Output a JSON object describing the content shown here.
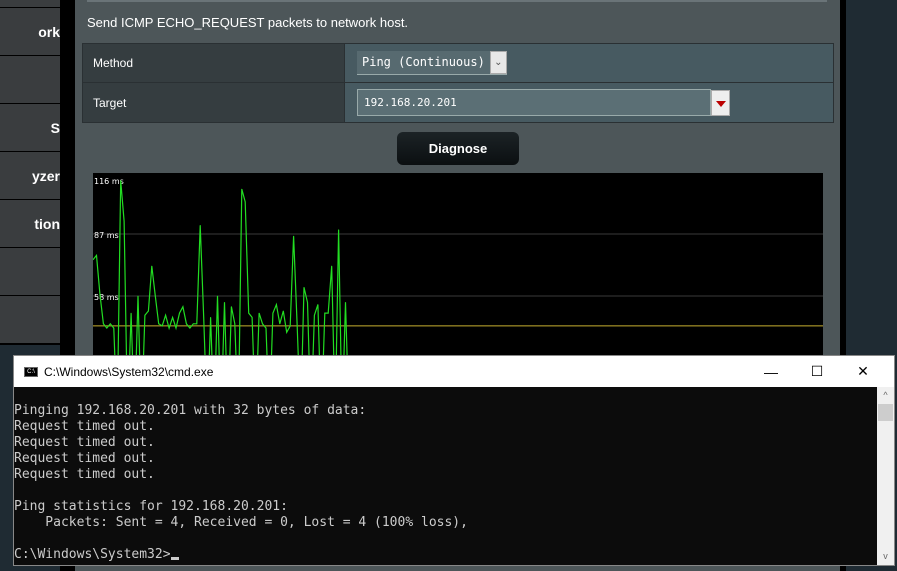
{
  "sidebar": {
    "items": [
      {
        "label": ""
      },
      {
        "label": "ork"
      },
      {
        "label": ""
      },
      {
        "label": "S"
      },
      {
        "label": "yzer"
      },
      {
        "label": "tion"
      },
      {
        "label": ""
      }
    ]
  },
  "panel": {
    "description": "Send ICMP ECHO_REQUEST packets to network host.",
    "method_label": "Method",
    "method_value": "Ping (Continuous)",
    "target_label": "Target",
    "target_value": "192.168.20.201",
    "diagnose_label": "Diagnose"
  },
  "chart_data": {
    "type": "line",
    "ytick_labels": [
      "116 ms",
      "87 ms",
      "58 ms"
    ],
    "yticks": [
      116,
      87,
      58
    ],
    "baseline_value": 44,
    "line_color": "#22dd22",
    "baseline_color": "#c8b030",
    "values": [
      75,
      77,
      59,
      45,
      43,
      45,
      43,
      0,
      112,
      93,
      0,
      50,
      0,
      58,
      0,
      49,
      51,
      72,
      58,
      45,
      44,
      49,
      43,
      48,
      43,
      50,
      53,
      45,
      43,
      45,
      45,
      91,
      48,
      0,
      48,
      0,
      58,
      0,
      55,
      0,
      53,
      45,
      0,
      108,
      102,
      50,
      48,
      0,
      50,
      45,
      43,
      0,
      50,
      54,
      45,
      51,
      41,
      44,
      86,
      45,
      0,
      62,
      55,
      0,
      49,
      54,
      0,
      50,
      50,
      72,
      0,
      89,
      0,
      55,
      0
    ]
  },
  "cmd": {
    "title": "C:\\Windows\\System32\\cmd.exe",
    "lines": [
      "Pinging 192.168.20.201 with 32 bytes of data:",
      "Request timed out.",
      "Request timed out.",
      "Request timed out.",
      "Request timed out.",
      "",
      "Ping statistics for 192.168.20.201:",
      "    Packets: Sent = 4, Received = 0, Lost = 4 (100% loss),",
      ""
    ],
    "prompt": "C:\\Windows\\System32>"
  }
}
